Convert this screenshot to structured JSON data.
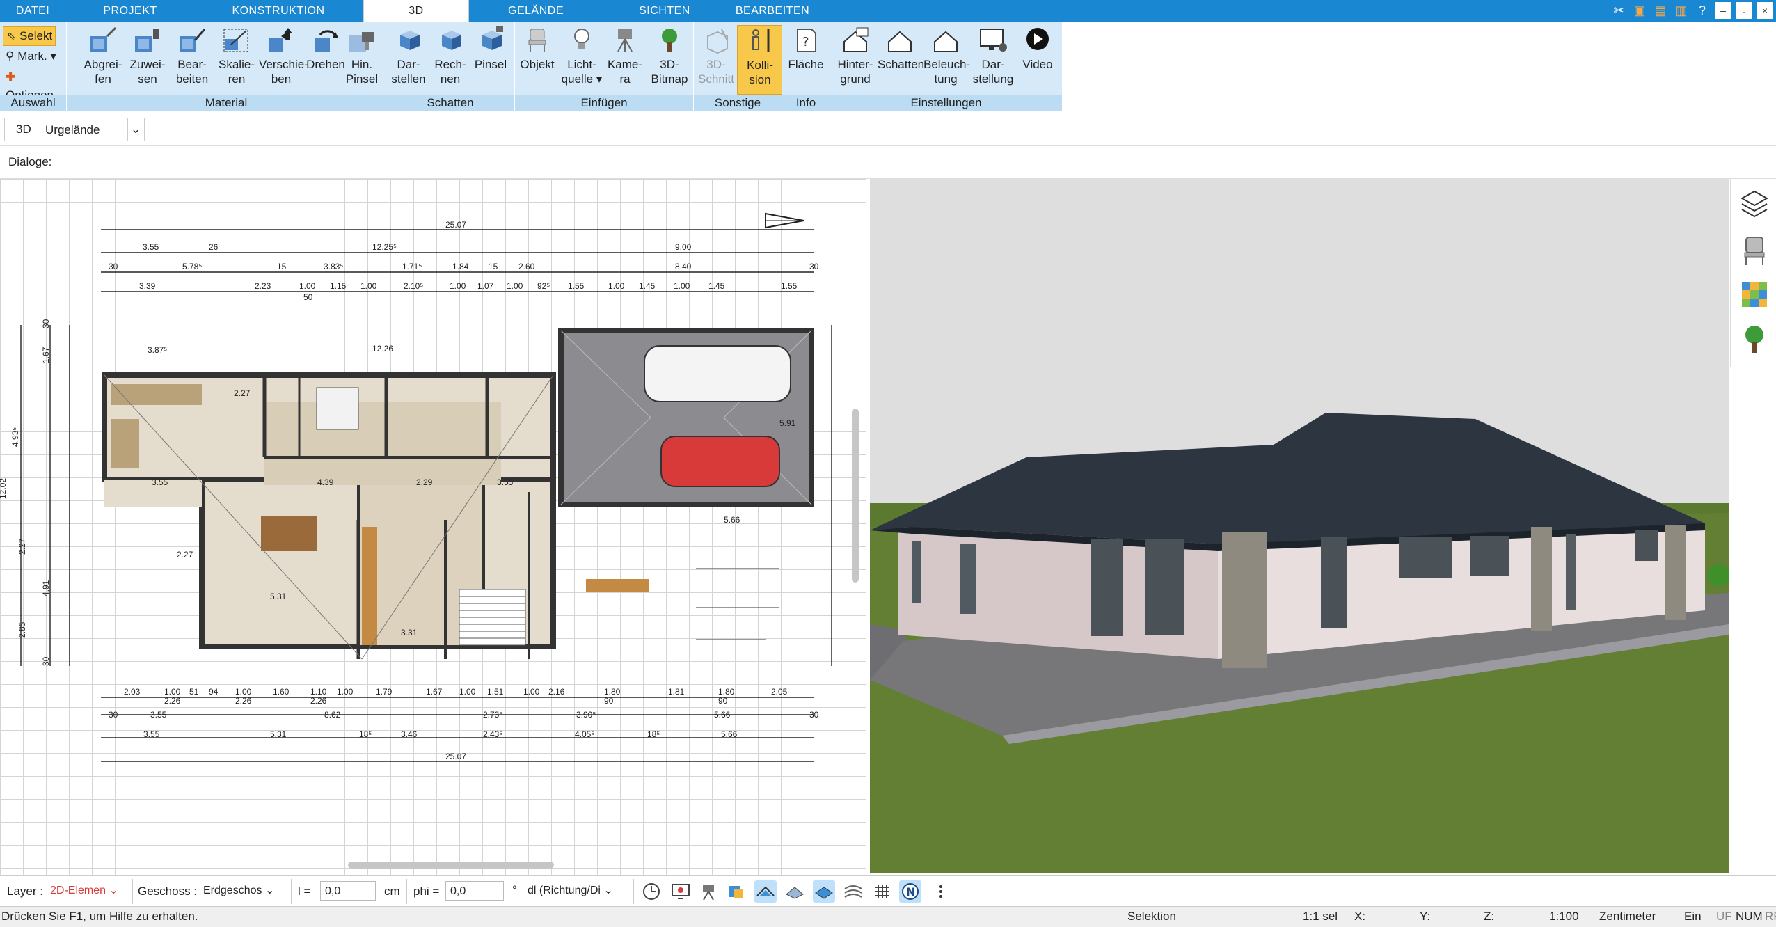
{
  "menu": {
    "tabs": [
      "DATEI",
      "PROJEKT",
      "KONSTRUKTION",
      "3D",
      "GELÄNDE",
      "SICHTEN",
      "BEARBEITEN"
    ],
    "active": "3D"
  },
  "ribbon": {
    "auswahl": {
      "selekt": "Selekt",
      "mark": "Mark.",
      "optionen": "Optionen",
      "label": "Auswahl"
    },
    "material": {
      "label": "Material",
      "buttons": [
        "Abgrei-\nfen",
        "Zuwei-\nsen",
        "Bear-\nbeiten",
        "Skalie-\nren",
        "Verschie-\nben",
        "Drehen",
        "Hin.\nPinsel"
      ]
    },
    "schatten": {
      "label": "Schatten",
      "buttons": [
        "Dar-\nstellen",
        "Rech-\nnen",
        "Pinsel"
      ]
    },
    "einfuegen": {
      "label": "Einfügen",
      "buttons": [
        "Objekt",
        "Licht-\nquelle",
        "Kame-\nra",
        "3D-\nBitmap"
      ]
    },
    "sonstige": {
      "label": "Sonstige",
      "buttons": [
        "3D-\nSchnitt",
        "Kolli-\nsion"
      ]
    },
    "info": {
      "label": "Info",
      "buttons": [
        "Fläche"
      ]
    },
    "einstellungen": {
      "label": "Einstellungen",
      "buttons": [
        "Hinter-\ngrund",
        "Schatten",
        "Beleuch-\ntung",
        "Dar-\nstellung",
        "Video"
      ]
    }
  },
  "toolbar3d": {
    "mode": "3D",
    "select_value": "Urgelände"
  },
  "dialoge": {
    "label": "Dialoge:"
  },
  "plan": {
    "dims_top": [
      "25.07",
      "3.55",
      "26",
      "12.25⁵",
      "9.00",
      "30",
      "5.78⁵",
      "15",
      "3.83⁵",
      "1.71⁵",
      "1.84",
      "15",
      "2.60",
      "8.40",
      "30",
      "3.39",
      "2.23",
      "1.00",
      "1.15",
      "1.00",
      "2.10⁵",
      "1.00",
      "1.07",
      "1.00",
      "92⁵",
      "1.55",
      "1.00",
      "1.45",
      "1.00",
      "1.45",
      "1.55",
      "50"
    ],
    "dims_bottom": [
      "2.03",
      "1.00",
      "51",
      "94",
      "1.00",
      "1.60",
      "1.10",
      "1.00",
      "1.79",
      "1.67",
      "1.00",
      "1.51",
      "1.00",
      "2.16",
      "1.80",
      "1.81",
      "1.80",
      "2.05",
      "2.26",
      "2.26",
      "2.26",
      "90",
      "90",
      "30",
      "3.55",
      "8.62",
      "2.73⁵",
      "3.90⁵",
      "5.66",
      "30",
      "3.55",
      "5.31",
      "18⁵",
      "3.46",
      "2.43⁵",
      "4.05⁵",
      "18⁵",
      "5.66",
      "25.07"
    ],
    "dims_left": [
      "30",
      "1.67",
      "4.93⁵",
      "12.02",
      "2.27",
      "4.91",
      "2.85",
      "30"
    ],
    "room_labels": [
      "2.27",
      "3.55",
      "4.39",
      "2.29",
      "3.55",
      "5.31",
      "3.31",
      "2.27",
      "12.26",
      "3.87⁵",
      "5.66",
      "5.91"
    ]
  },
  "rightbar": {
    "icons": [
      "layers-icon",
      "chair-icon",
      "material-palette-icon",
      "tree-icon"
    ]
  },
  "bottombar": {
    "layer_label": "Layer :",
    "layer_value": "2D-Elemen",
    "geschoss_label": "Geschoss :",
    "geschoss_value": "Erdgeschos",
    "l_label": "l =",
    "l_value": "0,0",
    "l_unit": "cm",
    "phi_label": "phi =",
    "phi_value": "0,0",
    "phi_unit": "°",
    "direction_value": "dl (Richtung/Di"
  },
  "status": {
    "help": "Drücken Sie F1, um Hilfe zu erhalten.",
    "mode": "Selektion",
    "scale_sel": "1:1 sel",
    "x": "X:",
    "y": "Y:",
    "z": "Z:",
    "scale": "1:100",
    "unit": "Zentimeter",
    "ein": "Ein",
    "uf": "UF",
    "num": "NUM",
    "rf": "RF"
  },
  "colors": {
    "menubar": "#1a87d3",
    "ribbon_group": "#d6e9f8",
    "ribbon_label": "#bcdcf4",
    "selected": "#f7c84a",
    "roof": "#2d3540",
    "wall": "#e8dede",
    "grass": "#5c7a2f",
    "sky": "#dedede",
    "stone": "#8f8a80"
  }
}
